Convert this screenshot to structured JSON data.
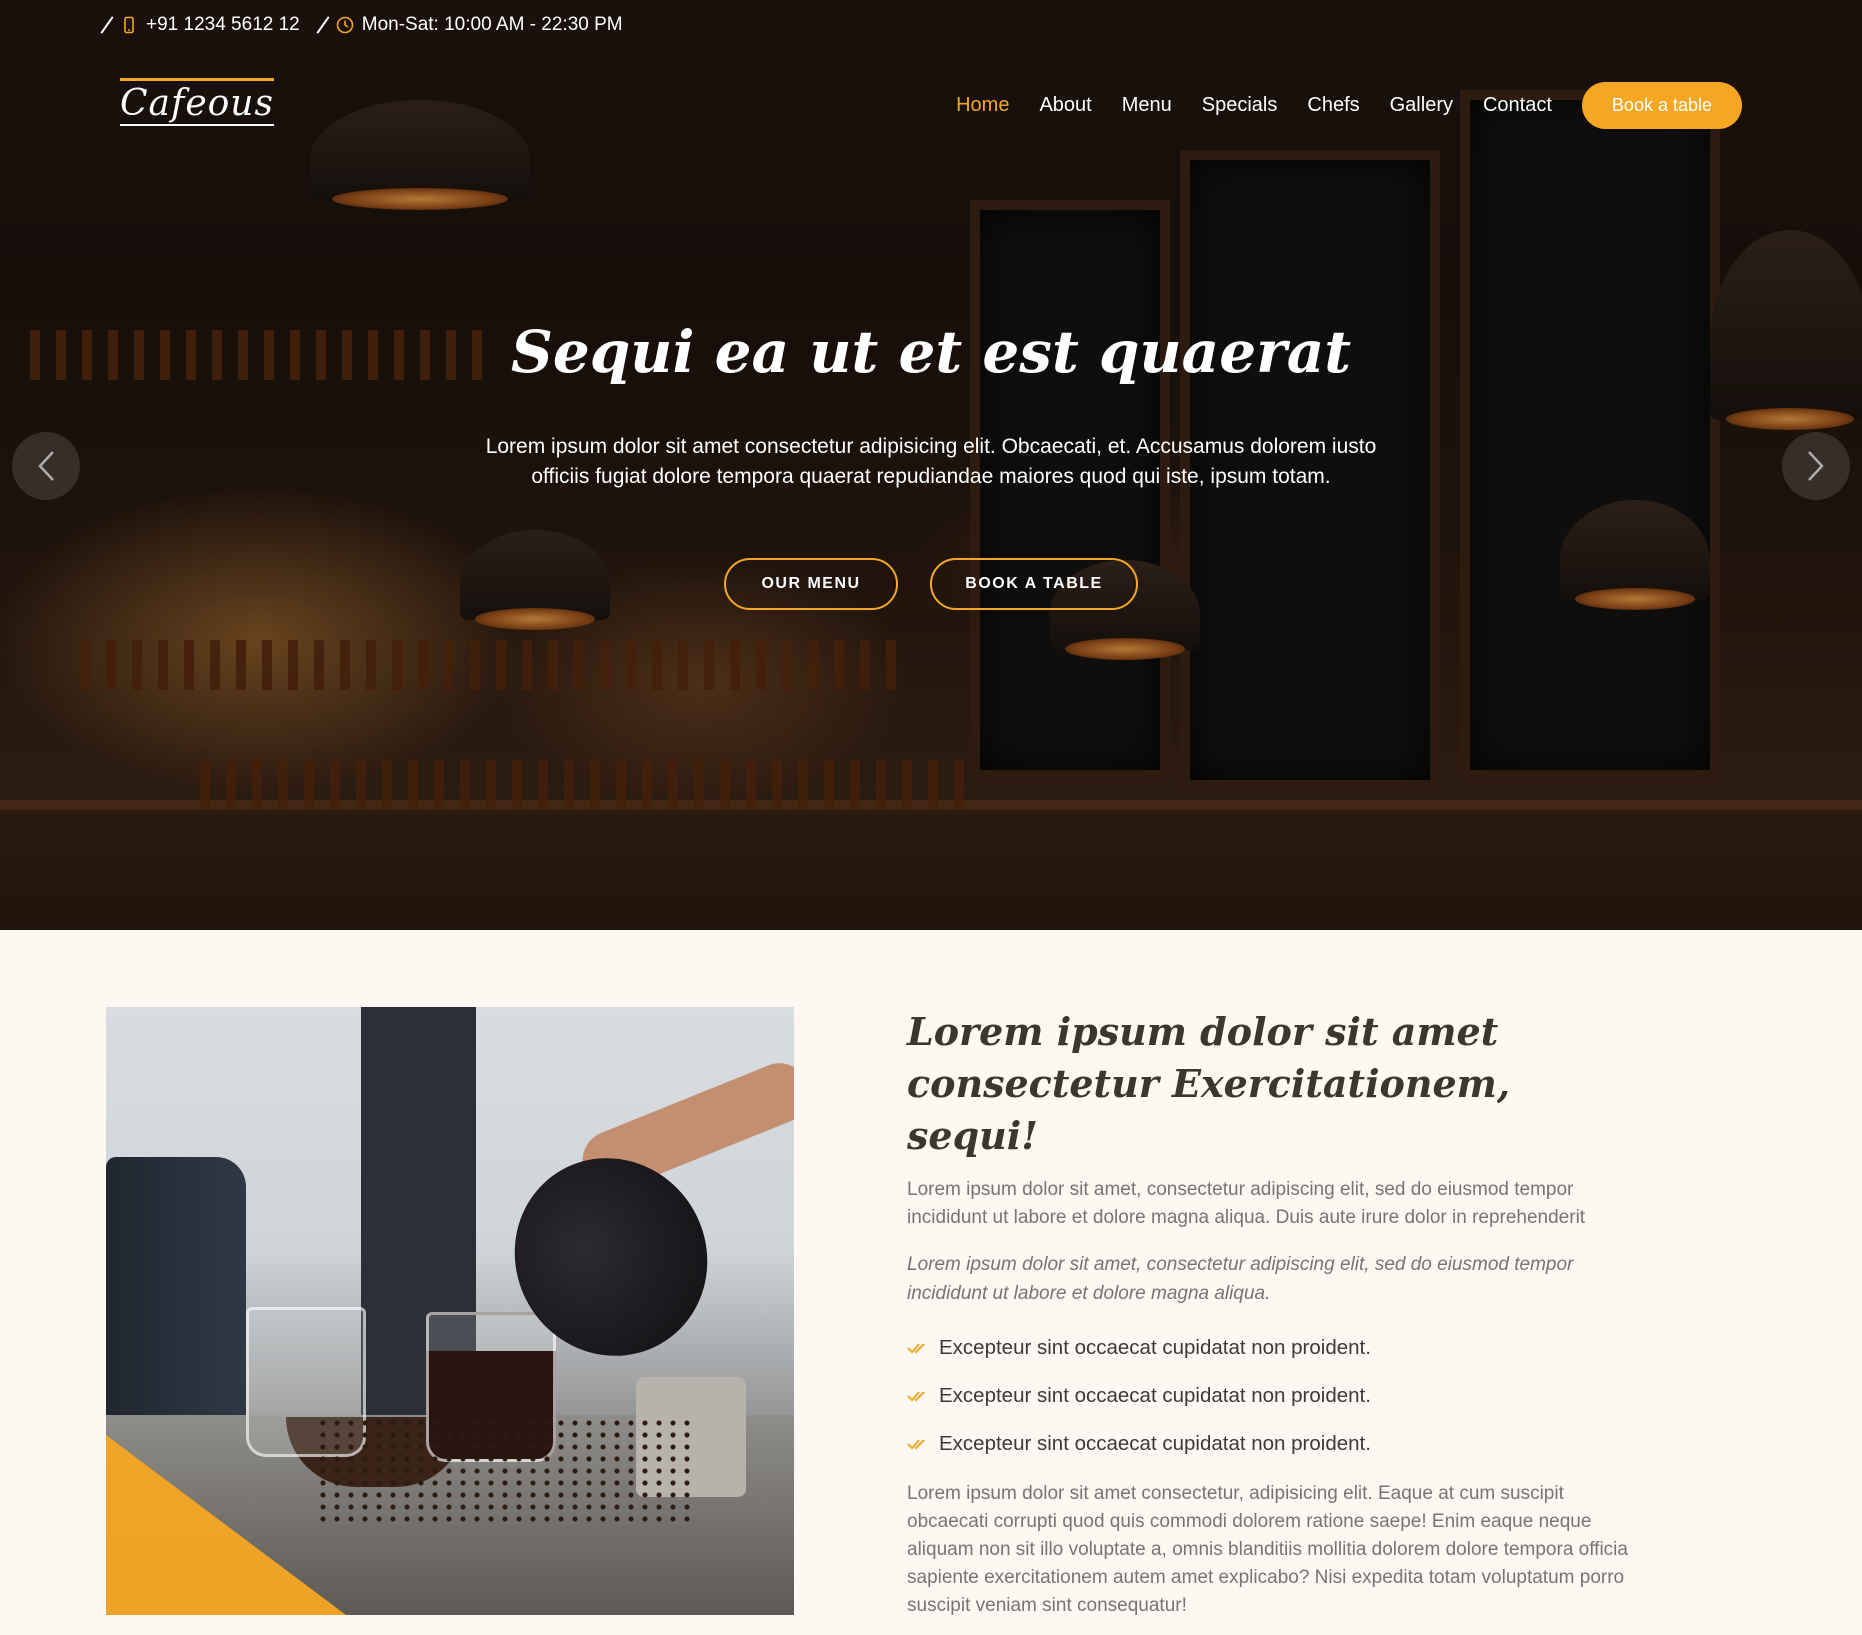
{
  "topbar": {
    "phone": "+91 1234 5612 12",
    "hours": "Mon-Sat: 10:00 AM - 22:30 PM"
  },
  "logo": "Cafeous",
  "nav": {
    "items": [
      "Home",
      "About",
      "Menu",
      "Specials",
      "Chefs",
      "Gallery",
      "Contact"
    ],
    "active": "Home",
    "cta": "Book a table"
  },
  "hero": {
    "title": "Sequi ea ut et est quaerat",
    "text": "Lorem ipsum dolor sit amet consectetur adipisicing elit. Obcaecati, et. Accusamus dolorem iusto officiis fugiat dolore tempora quaerat repudiandae maiores quod qui iste, ipsum totam.",
    "btn_menu": "OUR MENU",
    "btn_table": "BOOK A TABLE",
    "prev_icon": "chevron-left-icon",
    "next_icon": "chevron-right-icon"
  },
  "about": {
    "heading": "Lorem ipsum dolor sit amet consectetur Exercitationem, sequi!",
    "lead": "Lorem ipsum dolor sit amet, consectetur adipiscing elit, sed do eiusmod tempor incididunt ut labore et dolore magna aliqua. Duis aute irure dolor in reprehenderit",
    "italic": "Lorem ipsum dolor sit amet, consectetur adipiscing elit, sed do eiusmod tempor incididunt ut labore et dolore magna aliqua.",
    "checklist": [
      "Excepteur sint occaecat cupidatat non proident.",
      "Excepteur sint occaecat cupidatat non proident.",
      "Excepteur sint occaecat cupidatat non proident."
    ],
    "tail": "Lorem ipsum dolor sit amet consectetur, adipisicing elit. Eaque at cum suscipit obcaecati corrupti quod quis commodi dolorem ratione saepe! Enim eaque neque aliquam non sit illo voluptate a, omnis blanditiis mollitia dolorem dolore tempora officia sapiente exercitationem autem amet explicabo? Nisi expedita totam voluptatum porro suscipit veniam sint consequatur!"
  },
  "colors": {
    "accent": "#f5a623",
    "background": "#fdf8f2"
  }
}
